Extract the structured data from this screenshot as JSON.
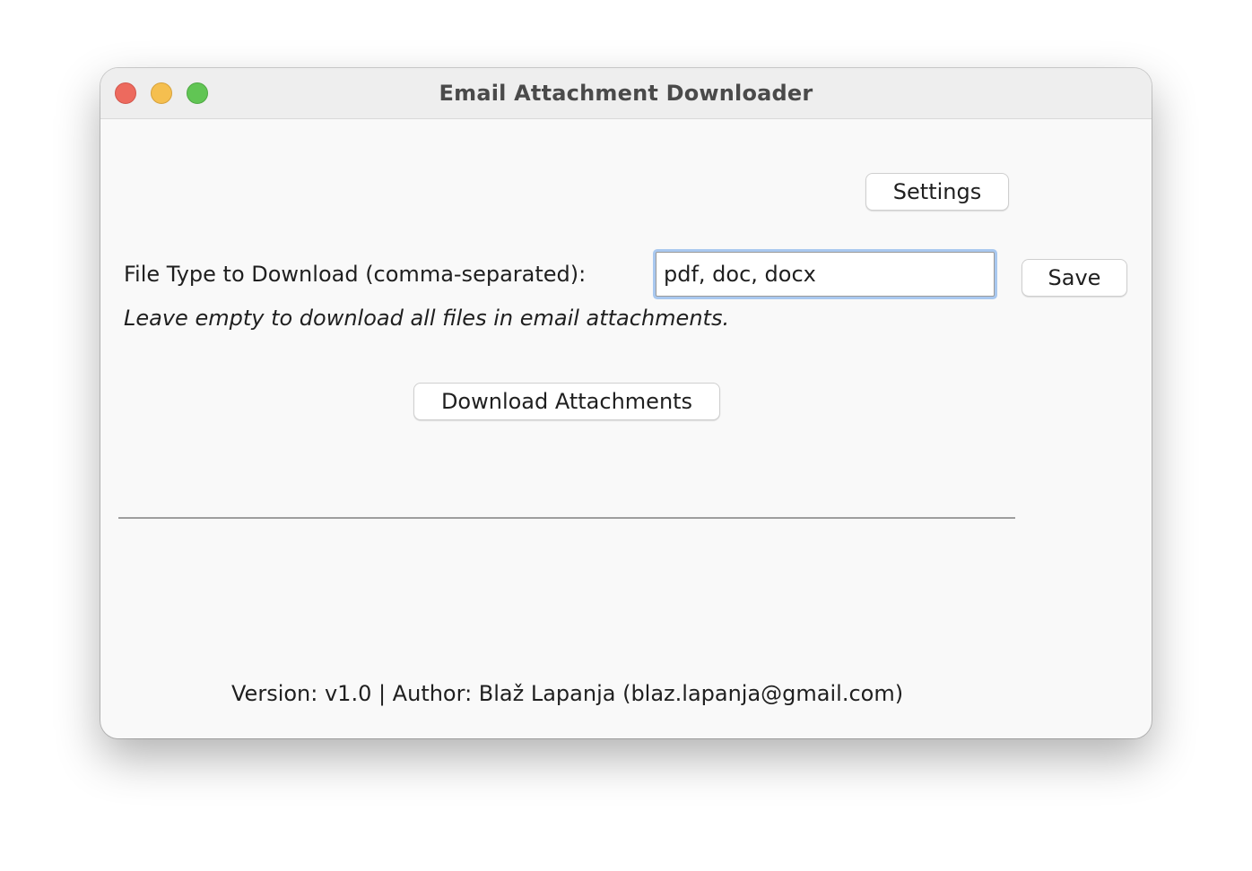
{
  "window": {
    "title": "Email Attachment Downloader",
    "controls": [
      "close",
      "minimize",
      "maximize"
    ]
  },
  "toolbar": {
    "settings_label": "Settings"
  },
  "file_type": {
    "label": "File Type to Download (comma-separated):",
    "value": "pdf, doc, docx",
    "save_label": "Save",
    "hint": "Leave empty to download all files in email attachments."
  },
  "actions": {
    "download_label": "Download Attachments"
  },
  "footer": {
    "text": "Version: v1.0 | Author: Blaž Lapanja (blaz.lapanja@gmail.com)"
  },
  "colors": {
    "close": "#ed6a5e",
    "minimize": "#f5bf4f",
    "maximize": "#61c554",
    "focus_ring": "#a9c8ef"
  }
}
